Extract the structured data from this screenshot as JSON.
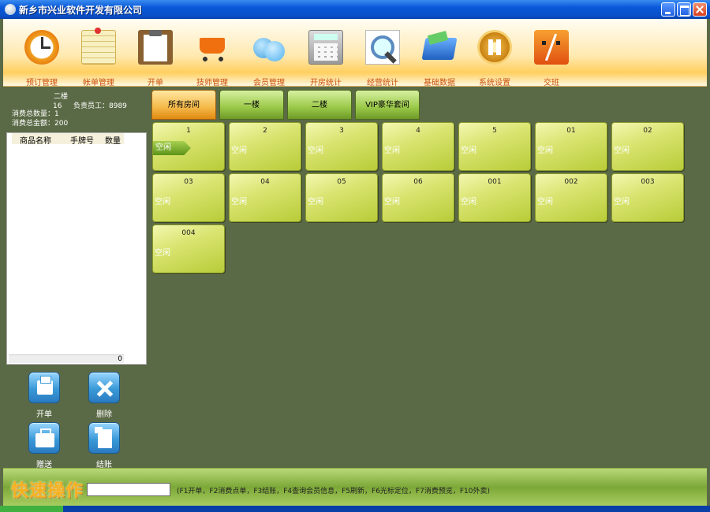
{
  "window": {
    "title": "新乡市兴业软件开发有限公司"
  },
  "toolbar": {
    "items": [
      {
        "label": "预订管理",
        "icon": "clock-icon"
      },
      {
        "label": "帐单管理",
        "icon": "note-icon"
      },
      {
        "label": "开单",
        "icon": "clipboard-icon"
      },
      {
        "label": "技师管理",
        "icon": "cart-icon"
      },
      {
        "label": "会员管理",
        "icon": "users-icon"
      },
      {
        "label": "开房统计",
        "icon": "calculator-icon"
      },
      {
        "label": "经营统计",
        "icon": "magnifier-icon"
      },
      {
        "label": "基础数据",
        "icon": "folder-icon"
      },
      {
        "label": "系统设置",
        "icon": "gear-icon"
      },
      {
        "label": "交班",
        "icon": "face-icon"
      }
    ]
  },
  "room_info": {
    "floor": "二楼",
    "room_number": "16",
    "staff": "负责员工：8989",
    "total_quantity": "消费总数量：1",
    "total_amount": "消费总金额：200"
  },
  "order_list": {
    "columns": [
      "商品名称",
      "手牌号",
      "数量"
    ],
    "total": "0"
  },
  "actions": {
    "open": "开单",
    "delete": "删除",
    "gift": "赠送",
    "checkout": "结账"
  },
  "tabs": [
    "所有房间",
    "一楼",
    "二楼",
    "VIP豪华套间"
  ],
  "rooms": [
    {
      "number": "1",
      "status": "空闲"
    },
    {
      "number": "2",
      "status": "空闲"
    },
    {
      "number": "3",
      "status": "空闲"
    },
    {
      "number": "4",
      "status": "空闲"
    },
    {
      "number": "5",
      "status": "空闲"
    },
    {
      "number": "01",
      "status": "空闲"
    },
    {
      "number": "02",
      "status": "空闲"
    },
    {
      "number": "03",
      "status": "空闲"
    },
    {
      "number": "04",
      "status": "空闲"
    },
    {
      "number": "05",
      "status": "空闲"
    },
    {
      "number": "06",
      "status": "空闲"
    },
    {
      "number": "001",
      "status": "空闲"
    },
    {
      "number": "002",
      "status": "空闲"
    },
    {
      "number": "003",
      "status": "空闲"
    },
    {
      "number": "004",
      "status": "空闲"
    }
  ],
  "quick": {
    "title": "快速操作",
    "input_value": "",
    "hint": "(F1开单，F2消费点单，F3结账，F4查询会员信息，F5刷新，F6光标定位，F7消费预览，F10外卖)"
  }
}
